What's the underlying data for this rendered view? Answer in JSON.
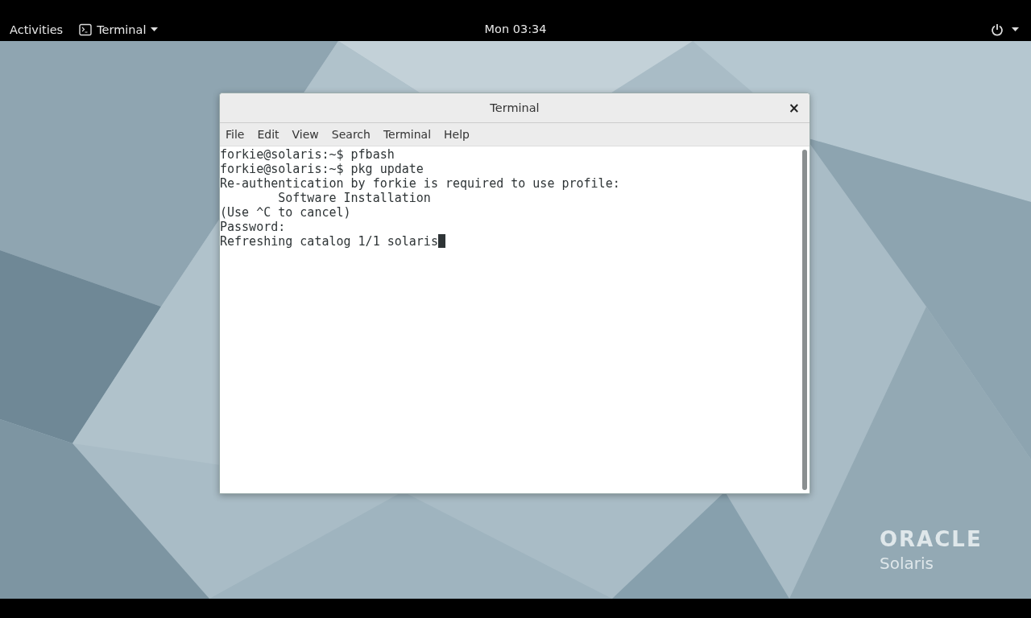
{
  "top_bar": {
    "activities": "Activities",
    "app_menu": "Terminal",
    "clock": "Mon 03:34"
  },
  "window": {
    "title": "Terminal",
    "close": "×",
    "menu": [
      "File",
      "Edit",
      "View",
      "Search",
      "Terminal",
      "Help"
    ],
    "lines": [
      "forkie@solaris:~$ pfbash",
      "forkie@solaris:~$ pkg update",
      "Re-authentication by forkie is required to use profile:",
      "        Software Installation",
      "(Use ^C to cancel)",
      "Password:",
      "Refreshing catalog 1/1 solaris"
    ]
  },
  "desktop_logo": {
    "brand": "ORACLE",
    "product": "Solaris"
  }
}
